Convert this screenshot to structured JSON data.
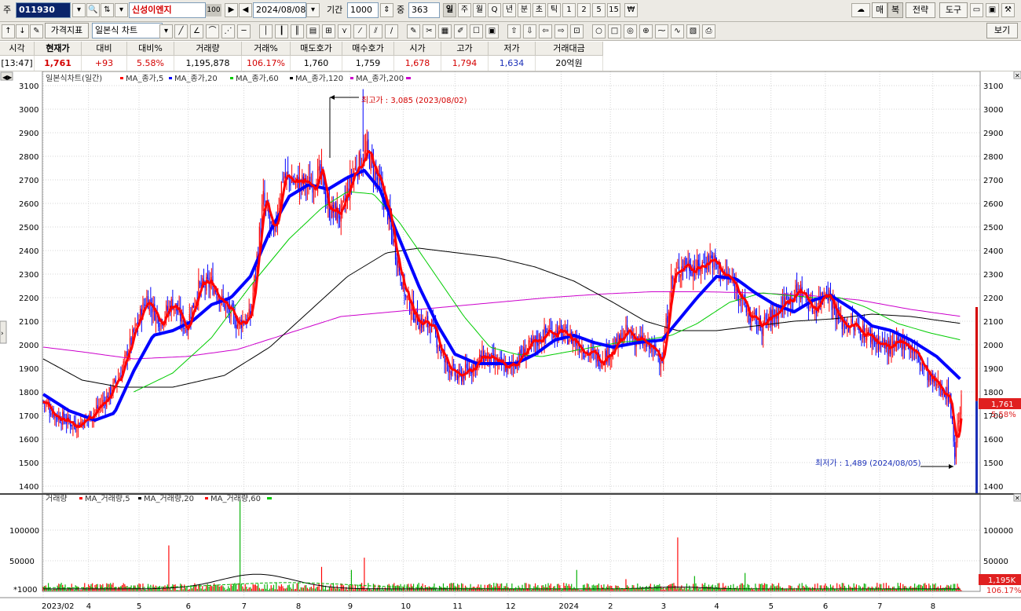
{
  "toolbar": {
    "type_label": "주",
    "stock_code": "011930",
    "stock_name": "신성이엔지",
    "stock_pct_badge": "100",
    "date": "2024/08/08",
    "period_label": "기간",
    "period_value": "1000",
    "count_label": "중",
    "count_value": "363",
    "period_buttons": [
      "일",
      "주",
      "월",
      "Q",
      "년",
      "분",
      "초",
      "틱",
      "1",
      "2",
      "5",
      "15"
    ],
    "right_buttons": [
      "매",
      "복",
      "전략",
      "도구"
    ]
  },
  "toolbar2": {
    "price_indicator": "가격지표",
    "chart_type": "일본식 차트",
    "view_button": "보기"
  },
  "quote": {
    "headers": [
      "시각",
      "현재가",
      "대비",
      "대비%",
      "거래량",
      "거래%",
      "매도호가",
      "매수호가",
      "시가",
      "고가",
      "저가",
      "거래대금"
    ],
    "values": [
      "[13:47]",
      "1,761",
      "+93",
      "5.58%",
      "1,195,878",
      "106.17%",
      "1,760",
      "1,759",
      "1,678",
      "1,794",
      "1,634",
      "20억원"
    ]
  },
  "legend": {
    "price_title": "일본식차트(일간)",
    "price_ma": [
      "MA_종가,5",
      "MA_종가,20",
      "MA_종가,60",
      "MA_종가,120",
      "MA_종가,200"
    ],
    "volume_title": "거래량",
    "volume_ma": [
      "MA_거래량,5",
      "MA_거래량,20",
      "MA_거래량,60"
    ]
  },
  "annotations": {
    "high": "최고가 : 3,085 (2023/08/02)",
    "low": "최저가 : 1,489 (2024/08/05)",
    "price_badge": "1,761",
    "pct_badge": "5.58%",
    "vol_badge": "1,195K",
    "vol_pct_badge": "106.17%",
    "vol_unit": "*1000"
  },
  "colors": {
    "candle_up": "#ff0000",
    "candle_down": "#0000ff",
    "ma5": "#ff0000",
    "ma20": "#0000ff",
    "ma60": "#00cc00",
    "ma120": "#000000",
    "ma200": "#cc00cc"
  },
  "chart_data": {
    "type": "line",
    "y_ticks": [
      1400,
      1500,
      1600,
      1700,
      1800,
      1900,
      2000,
      2100,
      2200,
      2300,
      2400,
      2500,
      2600,
      2700,
      2800,
      2900,
      3000,
      3100
    ],
    "ylim": [
      1370,
      3160
    ],
    "volume_ticks": [
      50000,
      100000
    ],
    "volume_ylim": [
      0,
      150000
    ],
    "x_tick_labels": [
      "2023/02",
      "4",
      "5",
      "6",
      "7",
      "8",
      "9",
      "10",
      "11",
      "12",
      "2024",
      "2",
      "3",
      "4",
      "5",
      "6",
      "7",
      "8"
    ],
    "x_tick_index": [
      0,
      35,
      74,
      112,
      155,
      197,
      237,
      278,
      318,
      359,
      400,
      438,
      479,
      520,
      562,
      604,
      646,
      687
    ],
    "n_points": 710,
    "price_anchors": [
      [
        0,
        1760
      ],
      [
        10,
        1700
      ],
      [
        25,
        1660
      ],
      [
        35,
        1690
      ],
      [
        50,
        1780
      ],
      [
        60,
        1880
      ],
      [
        70,
        2050
      ],
      [
        80,
        2200
      ],
      [
        90,
        2100
      ],
      [
        100,
        2180
      ],
      [
        110,
        2070
      ],
      [
        120,
        2240
      ],
      [
        130,
        2260
      ],
      [
        140,
        2170
      ],
      [
        150,
        2090
      ],
      [
        160,
        2120
      ],
      [
        170,
        2620
      ],
      [
        178,
        2450
      ],
      [
        185,
        2720
      ],
      [
        195,
        2690
      ],
      [
        205,
        2680
      ],
      [
        215,
        2720
      ],
      [
        220,
        2580
      ],
      [
        230,
        2550
      ],
      [
        240,
        2740
      ],
      [
        250,
        2820
      ],
      [
        258,
        2700
      ],
      [
        265,
        2590
      ],
      [
        272,
        2400
      ],
      [
        280,
        2200
      ],
      [
        290,
        2100
      ],
      [
        300,
        2080
      ],
      [
        310,
        1930
      ],
      [
        320,
        1860
      ],
      [
        330,
        1900
      ],
      [
        340,
        1950
      ],
      [
        350,
        1920
      ],
      [
        360,
        1900
      ],
      [
        370,
        1960
      ],
      [
        380,
        2010
      ],
      [
        390,
        2060
      ],
      [
        400,
        2050
      ],
      [
        410,
        2020
      ],
      [
        420,
        1970
      ],
      [
        430,
        1940
      ],
      [
        440,
        1980
      ],
      [
        450,
        2050
      ],
      [
        460,
        2020
      ],
      [
        470,
        1980
      ],
      [
        478,
        1940
      ],
      [
        485,
        2270
      ],
      [
        495,
        2350
      ],
      [
        505,
        2320
      ],
      [
        515,
        2370
      ],
      [
        525,
        2300
      ],
      [
        535,
        2250
      ],
      [
        545,
        2120
      ],
      [
        555,
        2080
      ],
      [
        565,
        2130
      ],
      [
        575,
        2200
      ],
      [
        585,
        2230
      ],
      [
        595,
        2150
      ],
      [
        605,
        2240
      ],
      [
        615,
        2100
      ],
      [
        625,
        2080
      ],
      [
        635,
        2050
      ],
      [
        645,
        2010
      ],
      [
        655,
        1980
      ],
      [
        665,
        2020
      ],
      [
        675,
        1950
      ],
      [
        685,
        1850
      ],
      [
        695,
        1810
      ],
      [
        700,
        1780
      ],
      [
        704,
        1540
      ],
      [
        707,
        1700
      ],
      [
        709,
        1761
      ]
    ],
    "ma20_anchors": [
      [
        0,
        1790
      ],
      [
        20,
        1720
      ],
      [
        40,
        1680
      ],
      [
        55,
        1710
      ],
      [
        70,
        1890
      ],
      [
        85,
        2040
      ],
      [
        100,
        2060
      ],
      [
        115,
        2100
      ],
      [
        130,
        2170
      ],
      [
        145,
        2200
      ],
      [
        160,
        2290
      ],
      [
        175,
        2480
      ],
      [
        190,
        2630
      ],
      [
        205,
        2680
      ],
      [
        220,
        2660
      ],
      [
        235,
        2710
      ],
      [
        248,
        2740
      ],
      [
        260,
        2660
      ],
      [
        272,
        2490
      ],
      [
        290,
        2250
      ],
      [
        305,
        2080
      ],
      [
        318,
        1960
      ],
      [
        335,
        1920
      ],
      [
        350,
        1920
      ],
      [
        365,
        1920
      ],
      [
        380,
        1960
      ],
      [
        395,
        2020
      ],
      [
        410,
        2040
      ],
      [
        425,
        2010
      ],
      [
        440,
        1990
      ],
      [
        460,
        2010
      ],
      [
        478,
        2020
      ],
      [
        490,
        2100
      ],
      [
        505,
        2200
      ],
      [
        520,
        2290
      ],
      [
        535,
        2280
      ],
      [
        550,
        2220
      ],
      [
        565,
        2170
      ],
      [
        580,
        2140
      ],
      [
        595,
        2190
      ],
      [
        608,
        2210
      ],
      [
        625,
        2150
      ],
      [
        640,
        2080
      ],
      [
        655,
        2060
      ],
      [
        670,
        2020
      ],
      [
        690,
        1950
      ],
      [
        709,
        1850
      ]
    ],
    "ma60_anchors": [
      [
        70,
        1800
      ],
      [
        100,
        1880
      ],
      [
        130,
        2030
      ],
      [
        160,
        2250
      ],
      [
        190,
        2450
      ],
      [
        215,
        2580
      ],
      [
        235,
        2650
      ],
      [
        255,
        2640
      ],
      [
        275,
        2520
      ],
      [
        300,
        2320
      ],
      [
        325,
        2120
      ],
      [
        345,
        1990
      ],
      [
        365,
        1960
      ],
      [
        385,
        1950
      ],
      [
        405,
        1970
      ],
      [
        425,
        1990
      ],
      [
        445,
        2010
      ],
      [
        465,
        2020
      ],
      [
        485,
        2040
      ],
      [
        505,
        2090
      ],
      [
        530,
        2180
      ],
      [
        555,
        2220
      ],
      [
        575,
        2210
      ],
      [
        595,
        2200
      ],
      [
        615,
        2200
      ],
      [
        635,
        2160
      ],
      [
        660,
        2090
      ],
      [
        685,
        2050
      ],
      [
        709,
        2020
      ]
    ],
    "ma120_anchors": [
      [
        0,
        1940
      ],
      [
        30,
        1850
      ],
      [
        60,
        1820
      ],
      [
        100,
        1820
      ],
      [
        140,
        1870
      ],
      [
        175,
        1990
      ],
      [
        205,
        2140
      ],
      [
        235,
        2290
      ],
      [
        265,
        2390
      ],
      [
        290,
        2410
      ],
      [
        320,
        2390
      ],
      [
        350,
        2370
      ],
      [
        380,
        2330
      ],
      [
        410,
        2270
      ],
      [
        440,
        2180
      ],
      [
        465,
        2100
      ],
      [
        490,
        2060
      ],
      [
        520,
        2060
      ],
      [
        550,
        2080
      ],
      [
        580,
        2100
      ],
      [
        610,
        2110
      ],
      [
        640,
        2130
      ],
      [
        670,
        2120
      ],
      [
        709,
        2090
      ]
    ],
    "ma200_anchors": [
      [
        0,
        1990
      ],
      [
        30,
        1970
      ],
      [
        70,
        1940
      ],
      [
        110,
        1950
      ],
      [
        150,
        1980
      ],
      [
        190,
        2050
      ],
      [
        230,
        2120
      ],
      [
        270,
        2140
      ],
      [
        310,
        2160
      ],
      [
        350,
        2180
      ],
      [
        390,
        2200
      ],
      [
        430,
        2215
      ],
      [
        470,
        2225
      ],
      [
        510,
        2225
      ],
      [
        550,
        2220
      ],
      [
        590,
        2210
      ],
      [
        630,
        2190
      ],
      [
        670,
        2150
      ],
      [
        709,
        2120
      ]
    ],
    "volume_spikes": [
      [
        97,
        75000
      ],
      [
        152,
        150000
      ],
      [
        215,
        40000
      ],
      [
        238,
        35000
      ],
      [
        248,
        55000
      ],
      [
        412,
        35000
      ],
      [
        450,
        20000
      ],
      [
        490,
        88000
      ],
      [
        503,
        25000
      ],
      [
        542,
        30000
      ]
    ]
  }
}
